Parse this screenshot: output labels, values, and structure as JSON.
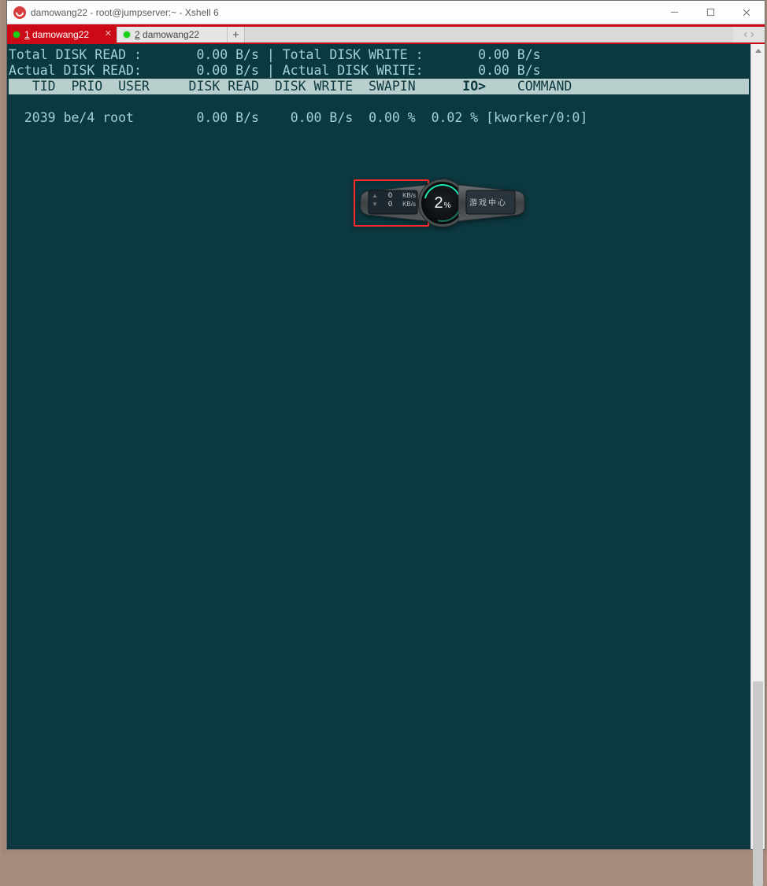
{
  "window": {
    "title": "damowang22 - root@jumpserver:~ - Xshell 6"
  },
  "tabs": {
    "t1_num": "1",
    "t1_name": " damowang22",
    "t2_num": "2",
    "t2_name": " damowang22"
  },
  "io": {
    "line1a": "Total DISK READ :",
    "line1a_val": "0.00 B/s",
    "line1b": "Total DISK WRITE :",
    "line1b_val": "0.00 B/s",
    "line2a": "Actual DISK READ:",
    "line2a_val": "0.00 B/s",
    "line2b": "Actual DISK WRITE:",
    "line2b_val": "0.00 B/s",
    "hdr": {
      "tid": "TID",
      "prio": "PRIO",
      "user": "USER",
      "dr": "DISK READ",
      "dw": "DISK WRITE",
      "swap": "SWAPIN",
      "io": "IO>",
      "cmd": "COMMAND"
    },
    "row": {
      "tid": "2039",
      "prio": "be/4",
      "user": "root",
      "dr": "0.00 B/s",
      "dw": "0.00 B/s",
      "swap": "0.00 %",
      "io": "0.02 %",
      "cmd": "[kworker/0:0]"
    }
  },
  "widget": {
    "up_val": "0",
    "up_unit": "KB/s",
    "down_val": "0",
    "down_unit": "KB/s",
    "pct_big": "2",
    "pct_sm": "%",
    "gamecenter": "游戏中心"
  }
}
